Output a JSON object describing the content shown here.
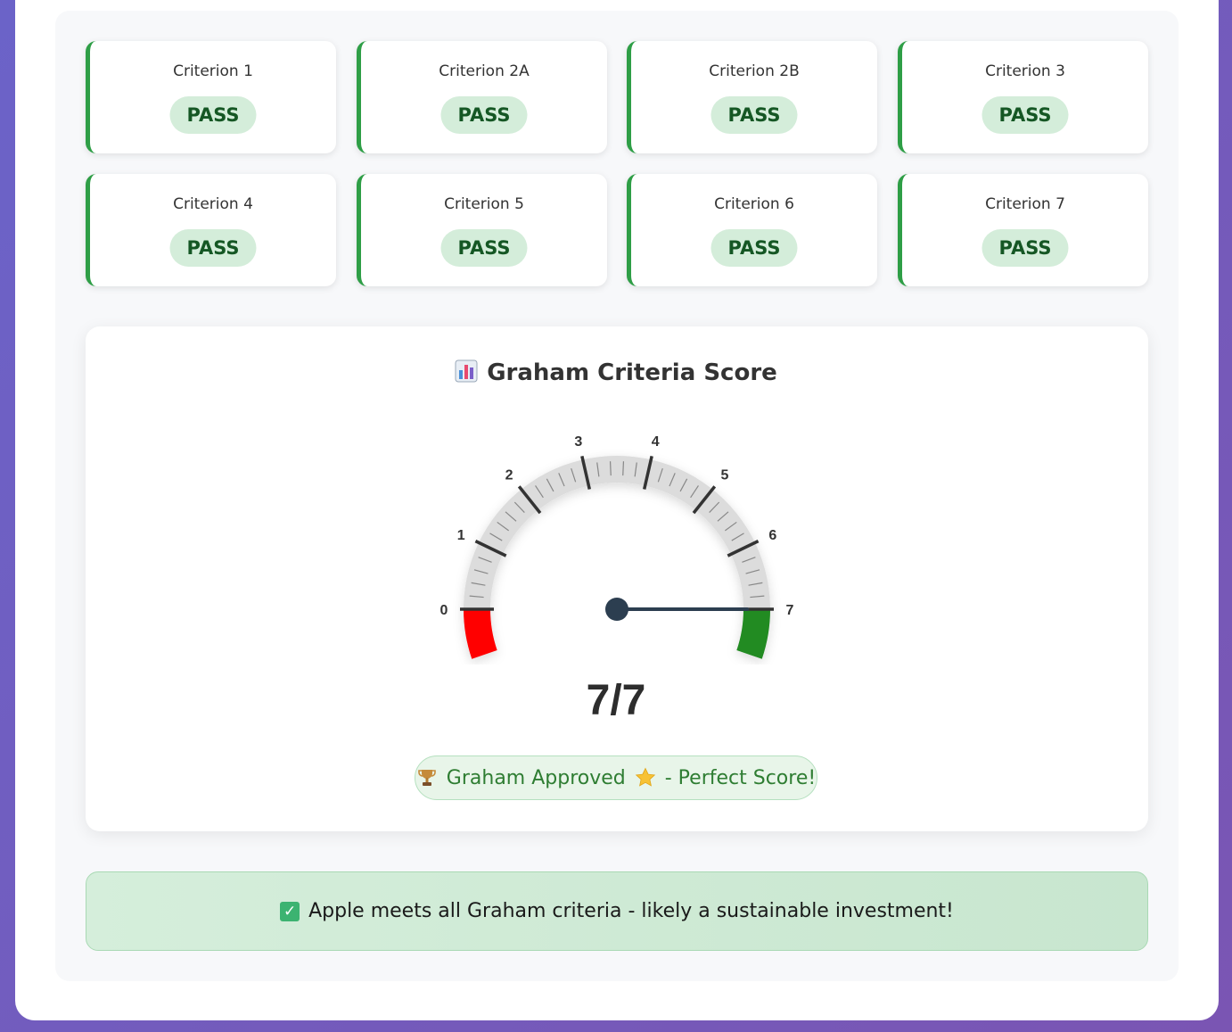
{
  "criteria": [
    {
      "name": "Criterion 1",
      "status": "PASS"
    },
    {
      "name": "Criterion 2A",
      "status": "PASS"
    },
    {
      "name": "Criterion 2B",
      "status": "PASS"
    },
    {
      "name": "Criterion 3",
      "status": "PASS"
    },
    {
      "name": "Criterion 4",
      "status": "PASS"
    },
    {
      "name": "Criterion 5",
      "status": "PASS"
    },
    {
      "name": "Criterion 6",
      "status": "PASS"
    },
    {
      "name": "Criterion 7",
      "status": "PASS"
    }
  ],
  "score_card": {
    "title": "Graham Criteria Score",
    "title_icon": "bar-chart-icon",
    "score_text": "7/7",
    "approved_text": "Graham Approved",
    "approved_suffix": "- Perfect Score!",
    "approved_icons": [
      "trophy-icon",
      "star-icon"
    ]
  },
  "gauge": {
    "min": 0,
    "max": 7,
    "value": 7,
    "tick_labels": [
      "0",
      "1",
      "2",
      "3",
      "4",
      "5",
      "6",
      "7"
    ],
    "low_color": "#ff0000",
    "high_color": "#228b22",
    "needle_color": "#2c3e50"
  },
  "verdict": {
    "icon": "check-icon",
    "text": "Apple meets all Graham criteria - likely a sustainable investment!"
  },
  "colors": {
    "pass_border": "#2e9e46",
    "pass_badge_bg": "#d4edda",
    "pass_badge_text": "#155724"
  }
}
